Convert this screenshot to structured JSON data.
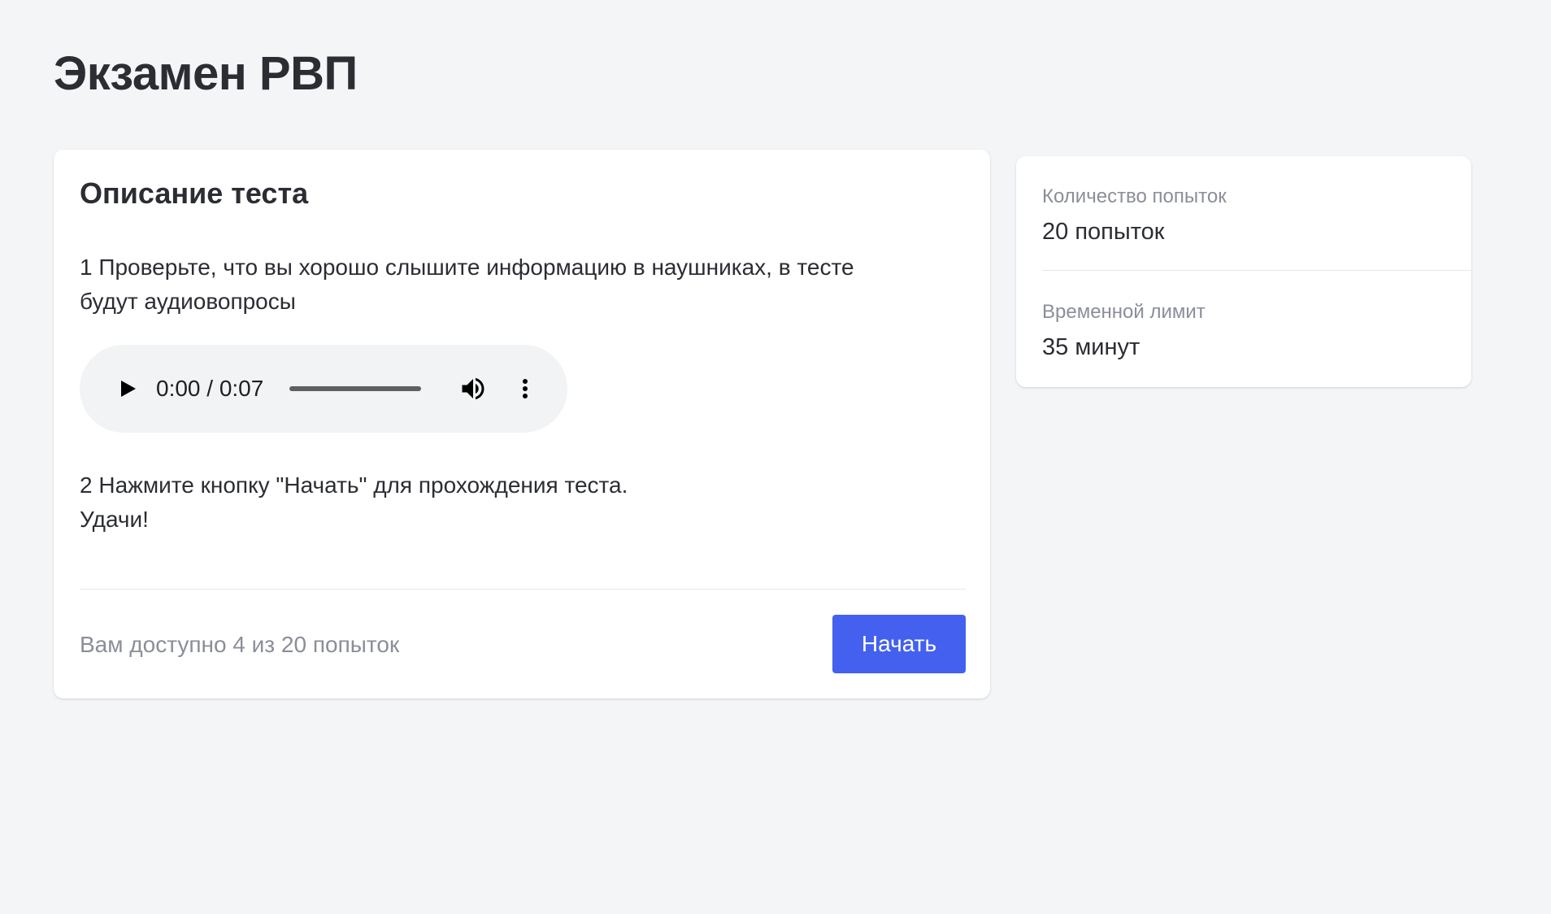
{
  "page": {
    "title": "Экзамен РВП"
  },
  "description": {
    "heading": "Описание теста",
    "step1": "1 Проверьте, что вы хорошо слышите  информацию в наушниках, в тесте\nбудут аудиовопросы",
    "step2": "2 Нажмите кнопку \"Начать\" для прохождения теста.\nУдачи!",
    "audio": {
      "time": "0:00 / 0:07",
      "progress": 0,
      "play_icon": "play-icon",
      "volume_icon": "volume-icon",
      "more_icon": "more-vertical-icon"
    },
    "attempts_note": "Вам доступно 4 из 20 попыток",
    "start_label": "Начать"
  },
  "sidebar": {
    "attempts_label": "Количество попыток",
    "attempts_value": "20 попыток",
    "time_limit_label": "Временной лимит",
    "time_limit_value": "35 минут"
  },
  "colors": {
    "background": "#f4f5f7",
    "accent": "#4361ee",
    "muted_text": "#8b8e99",
    "text": "#2b2d33"
  }
}
